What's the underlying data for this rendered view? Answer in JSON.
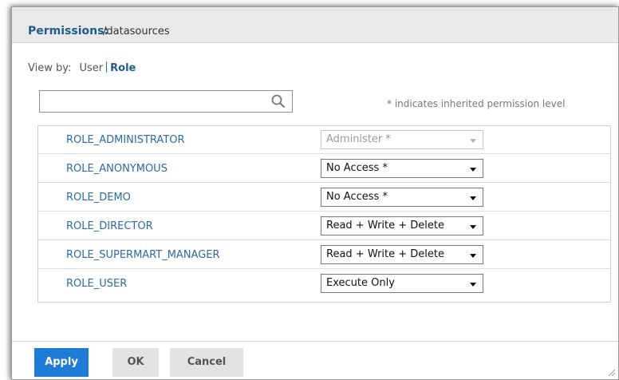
{
  "dialog": {
    "title_label": "Permissions:",
    "title_path": "/datasources"
  },
  "viewby": {
    "label": "View by:",
    "options": [
      "User",
      "Role"
    ],
    "selected": "Role"
  },
  "search": {
    "value": "",
    "placeholder": ""
  },
  "hint": "* indicates inherited permission level",
  "roles": [
    {
      "name": "ROLE_ADMINISTRATOR",
      "permission": "Administer *",
      "disabled": true
    },
    {
      "name": "ROLE_ANONYMOUS",
      "permission": "No Access *",
      "disabled": false
    },
    {
      "name": "ROLE_DEMO",
      "permission": "No Access *",
      "disabled": false
    },
    {
      "name": "ROLE_DIRECTOR",
      "permission": "Read + Write + Delete",
      "disabled": false
    },
    {
      "name": "ROLE_SUPERMART_MANAGER",
      "permission": "Read + Write + Delete",
      "disabled": false
    },
    {
      "name": "ROLE_USER",
      "permission": "Execute Only",
      "disabled": false
    }
  ],
  "buttons": {
    "apply": "Apply",
    "ok": "OK",
    "cancel": "Cancel"
  },
  "colors": {
    "accent": "#1f7bd8",
    "link": "#2c6aa5",
    "title": "#1f5b8f"
  }
}
